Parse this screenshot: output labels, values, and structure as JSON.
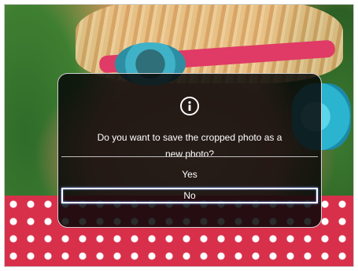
{
  "dialog": {
    "icon": "info-icon",
    "message_line1": "Do you want to save the cropped photo as a",
    "message_line2": "new photo?",
    "options": [
      {
        "label": "Yes",
        "selected": false
      },
      {
        "label": "No",
        "selected": true
      }
    ]
  }
}
